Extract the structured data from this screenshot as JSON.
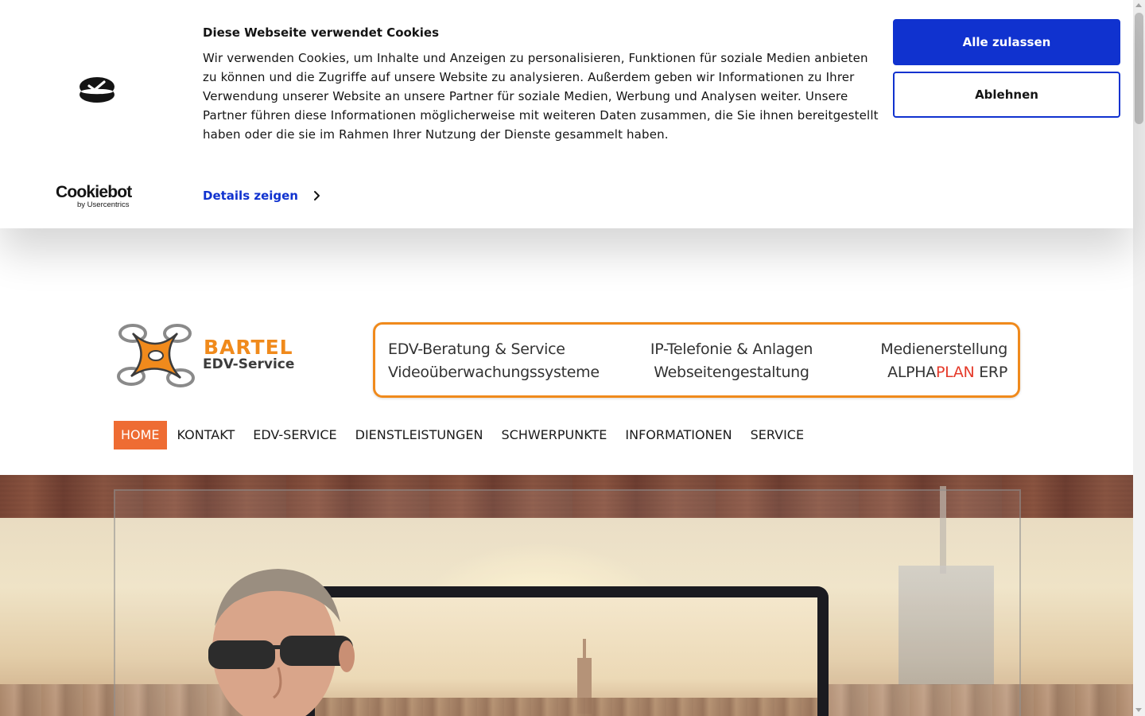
{
  "cookie_banner": {
    "title": "Diese Webseite verwendet Cookies",
    "text": "Wir verwenden Cookies, um Inhalte und Anzeigen zu personalisieren, Funktionen für soziale Medien anbieten zu können und die Zugriffe auf unsere Website zu analysieren. Außerdem geben wir Informationen zu Ihrer Verwendung unserer Website an unsere Partner für soziale Medien, Werbung und Analysen weiter. Unsere Partner führen diese Informationen möglicherweise mit weiteren Daten zusammen, die Sie ihnen bereitgestellt haben oder die sie im Rahmen Ihrer Nutzung der Dienste gesammelt haben.",
    "details_label": "Details zeigen",
    "allow_all_label": "Alle zulassen",
    "deny_label": "Ablehnen",
    "brand_name": "Cookiebot",
    "brand_sub": "by Usercentrics",
    "accent_color": "#1032cf"
  },
  "site": {
    "logo": {
      "name": "BARTEL",
      "subtitle": "EDV-Service",
      "icon": "drone-icon"
    },
    "services": {
      "col1_line1": "EDV-Beratung & Service",
      "col1_line2": "Videoüberwachungssysteme",
      "col2_line1": "IP-Telefonie & Anlagen",
      "col2_line2": "Webseitengestaltung",
      "col3_line1": "Medienerstellung",
      "col3_alpha": "ALPHA",
      "col3_plan": "PLAN",
      "col3_erp": " ERP"
    },
    "nav": [
      {
        "label": "HOME",
        "active": true
      },
      {
        "label": "KONTAKT",
        "active": false
      },
      {
        "label": "EDV-SERVICE",
        "active": false
      },
      {
        "label": "DIENSTLEISTUNGEN",
        "active": false
      },
      {
        "label": "SCHWERPUNKTE",
        "active": false
      },
      {
        "label": "INFORMATIONEN",
        "active": false
      },
      {
        "label": "SERVICE",
        "active": false
      }
    ],
    "brand_color": "#f08a1c",
    "nav_active_color": "#ee6c33"
  }
}
